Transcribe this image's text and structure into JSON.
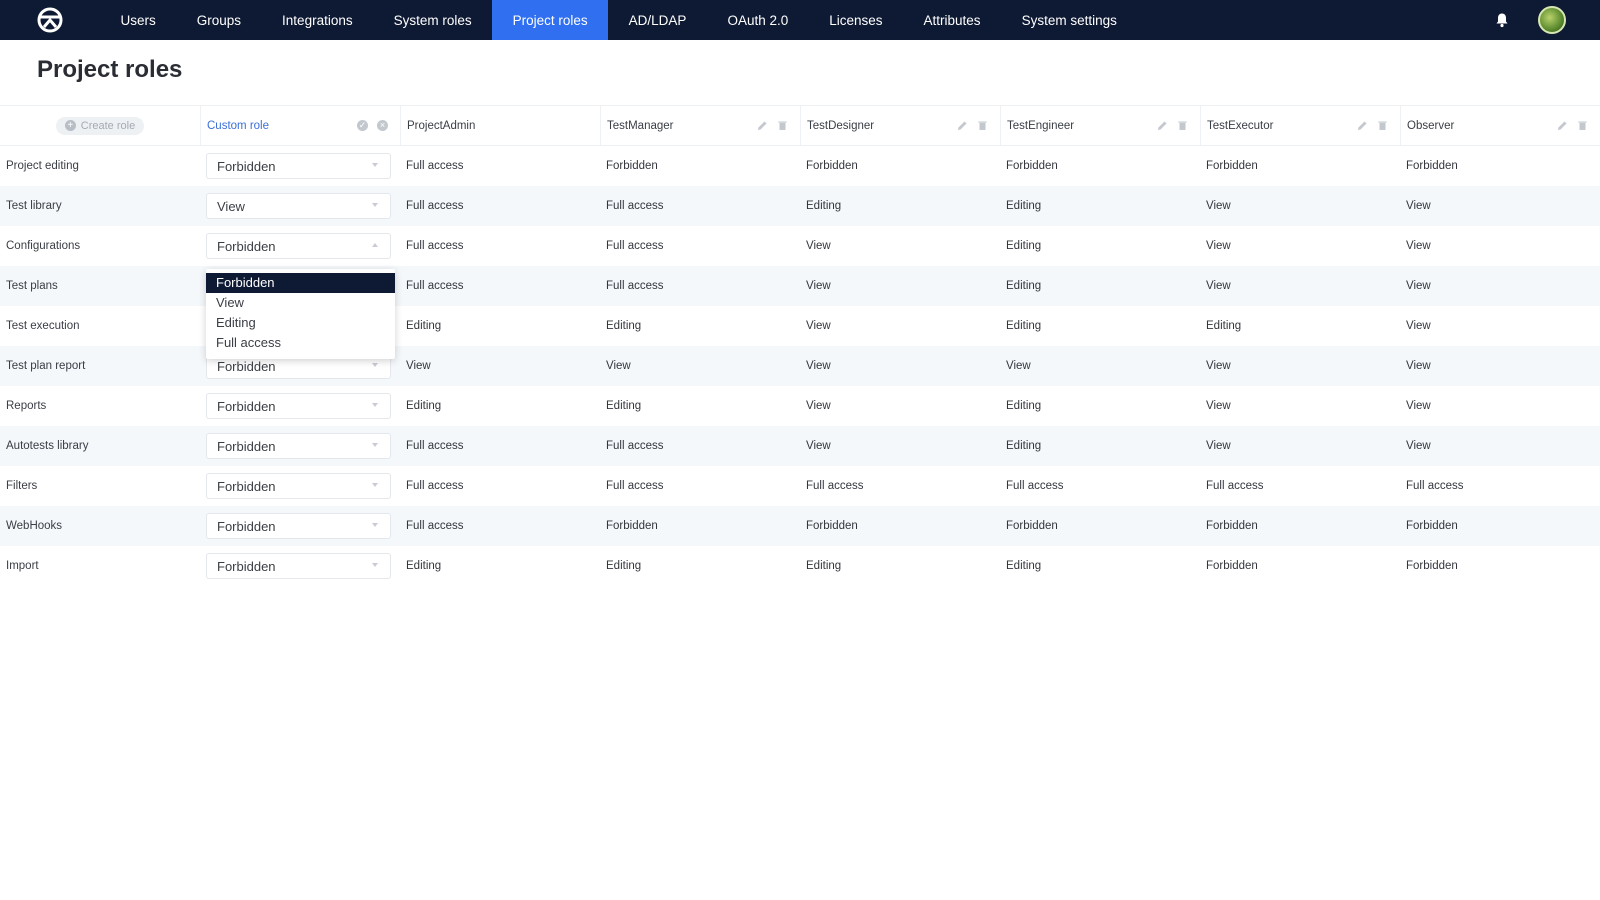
{
  "nav": {
    "items": [
      "Users",
      "Groups",
      "Integrations",
      "System roles",
      "Project roles",
      "AD/LDAP",
      "OAuth 2.0",
      "Licenses",
      "Attributes",
      "System settings"
    ],
    "active": "Project roles"
  },
  "page": {
    "title": "Project roles"
  },
  "table": {
    "create_label": "Create role",
    "custom_role_label": "Custom role",
    "roles": [
      "ProjectAdmin",
      "TestManager",
      "TestDesigner",
      "TestEngineer",
      "TestExecutor",
      "Observer"
    ],
    "rows": [
      {
        "name": "Project editing",
        "custom": "Forbidden",
        "values": [
          "Full access",
          "Forbidden",
          "Forbidden",
          "Forbidden",
          "Forbidden",
          "Forbidden"
        ]
      },
      {
        "name": "Test library",
        "custom": "View",
        "values": [
          "Full access",
          "Full access",
          "Editing",
          "Editing",
          "View",
          "View"
        ]
      },
      {
        "name": "Configurations",
        "custom": "Forbidden",
        "values": [
          "Full access",
          "Full access",
          "View",
          "Editing",
          "View",
          "View"
        ]
      },
      {
        "name": "Test plans",
        "custom": "",
        "values": [
          "Full access",
          "Full access",
          "View",
          "Editing",
          "View",
          "View"
        ]
      },
      {
        "name": "Test execution",
        "custom": "",
        "values": [
          "Editing",
          "Editing",
          "View",
          "Editing",
          "Editing",
          "View"
        ]
      },
      {
        "name": "Test plan report",
        "custom": "Forbidden",
        "values": [
          "View",
          "View",
          "View",
          "View",
          "View",
          "View"
        ]
      },
      {
        "name": "Reports",
        "custom": "Forbidden",
        "values": [
          "Editing",
          "Editing",
          "View",
          "Editing",
          "View",
          "View"
        ]
      },
      {
        "name": "Autotests library",
        "custom": "Forbidden",
        "values": [
          "Full access",
          "Full access",
          "View",
          "Editing",
          "View",
          "View"
        ]
      },
      {
        "name": "Filters",
        "custom": "Forbidden",
        "values": [
          "Full access",
          "Full access",
          "Full access",
          "Full access",
          "Full access",
          "Full access"
        ]
      },
      {
        "name": "WebHooks",
        "custom": "Forbidden",
        "values": [
          "Full access",
          "Forbidden",
          "Forbidden",
          "Forbidden",
          "Forbidden",
          "Forbidden"
        ]
      },
      {
        "name": "Import",
        "custom": "Forbidden",
        "values": [
          "Editing",
          "Editing",
          "Editing",
          "Editing",
          "Forbidden",
          "Forbidden"
        ]
      }
    ]
  },
  "dropdown": {
    "options": [
      "Forbidden",
      "View",
      "Editing",
      "Full access"
    ],
    "selected": "Forbidden"
  },
  "colors": {
    "nav_bg": "#0e1a33",
    "active_tab": "#2f6ff0",
    "link": "#3b6fd8",
    "row_alt": "#f4f8fb"
  }
}
